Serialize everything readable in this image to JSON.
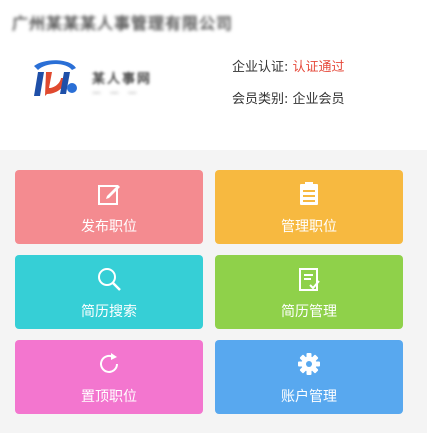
{
  "header": {
    "company_name": "广州某某某人事管理有限公司",
    "logo_text": "某人事网",
    "logo_sub": "— — —",
    "cert_label": "企业认证:",
    "cert_value": "认证通过",
    "member_label": "会员类别:",
    "member_value": "企业会员"
  },
  "colors": {
    "cert_value": "#e64a3b",
    "tile_publish": "#f48b90",
    "tile_manage": "#f7b940",
    "tile_search": "#36cfd6",
    "tile_resume_manage": "#8fd14a",
    "tile_top": "#f376cf",
    "tile_account": "#58a8ef"
  },
  "tiles": [
    {
      "label": "发布职位",
      "icon": "edit-icon"
    },
    {
      "label": "管理职位",
      "icon": "list-icon"
    },
    {
      "label": "简历搜索",
      "icon": "search-icon"
    },
    {
      "label": "简历管理",
      "icon": "document-icon"
    },
    {
      "label": "置顶职位",
      "icon": "refresh-icon"
    },
    {
      "label": "账户管理",
      "icon": "gear-icon"
    }
  ]
}
